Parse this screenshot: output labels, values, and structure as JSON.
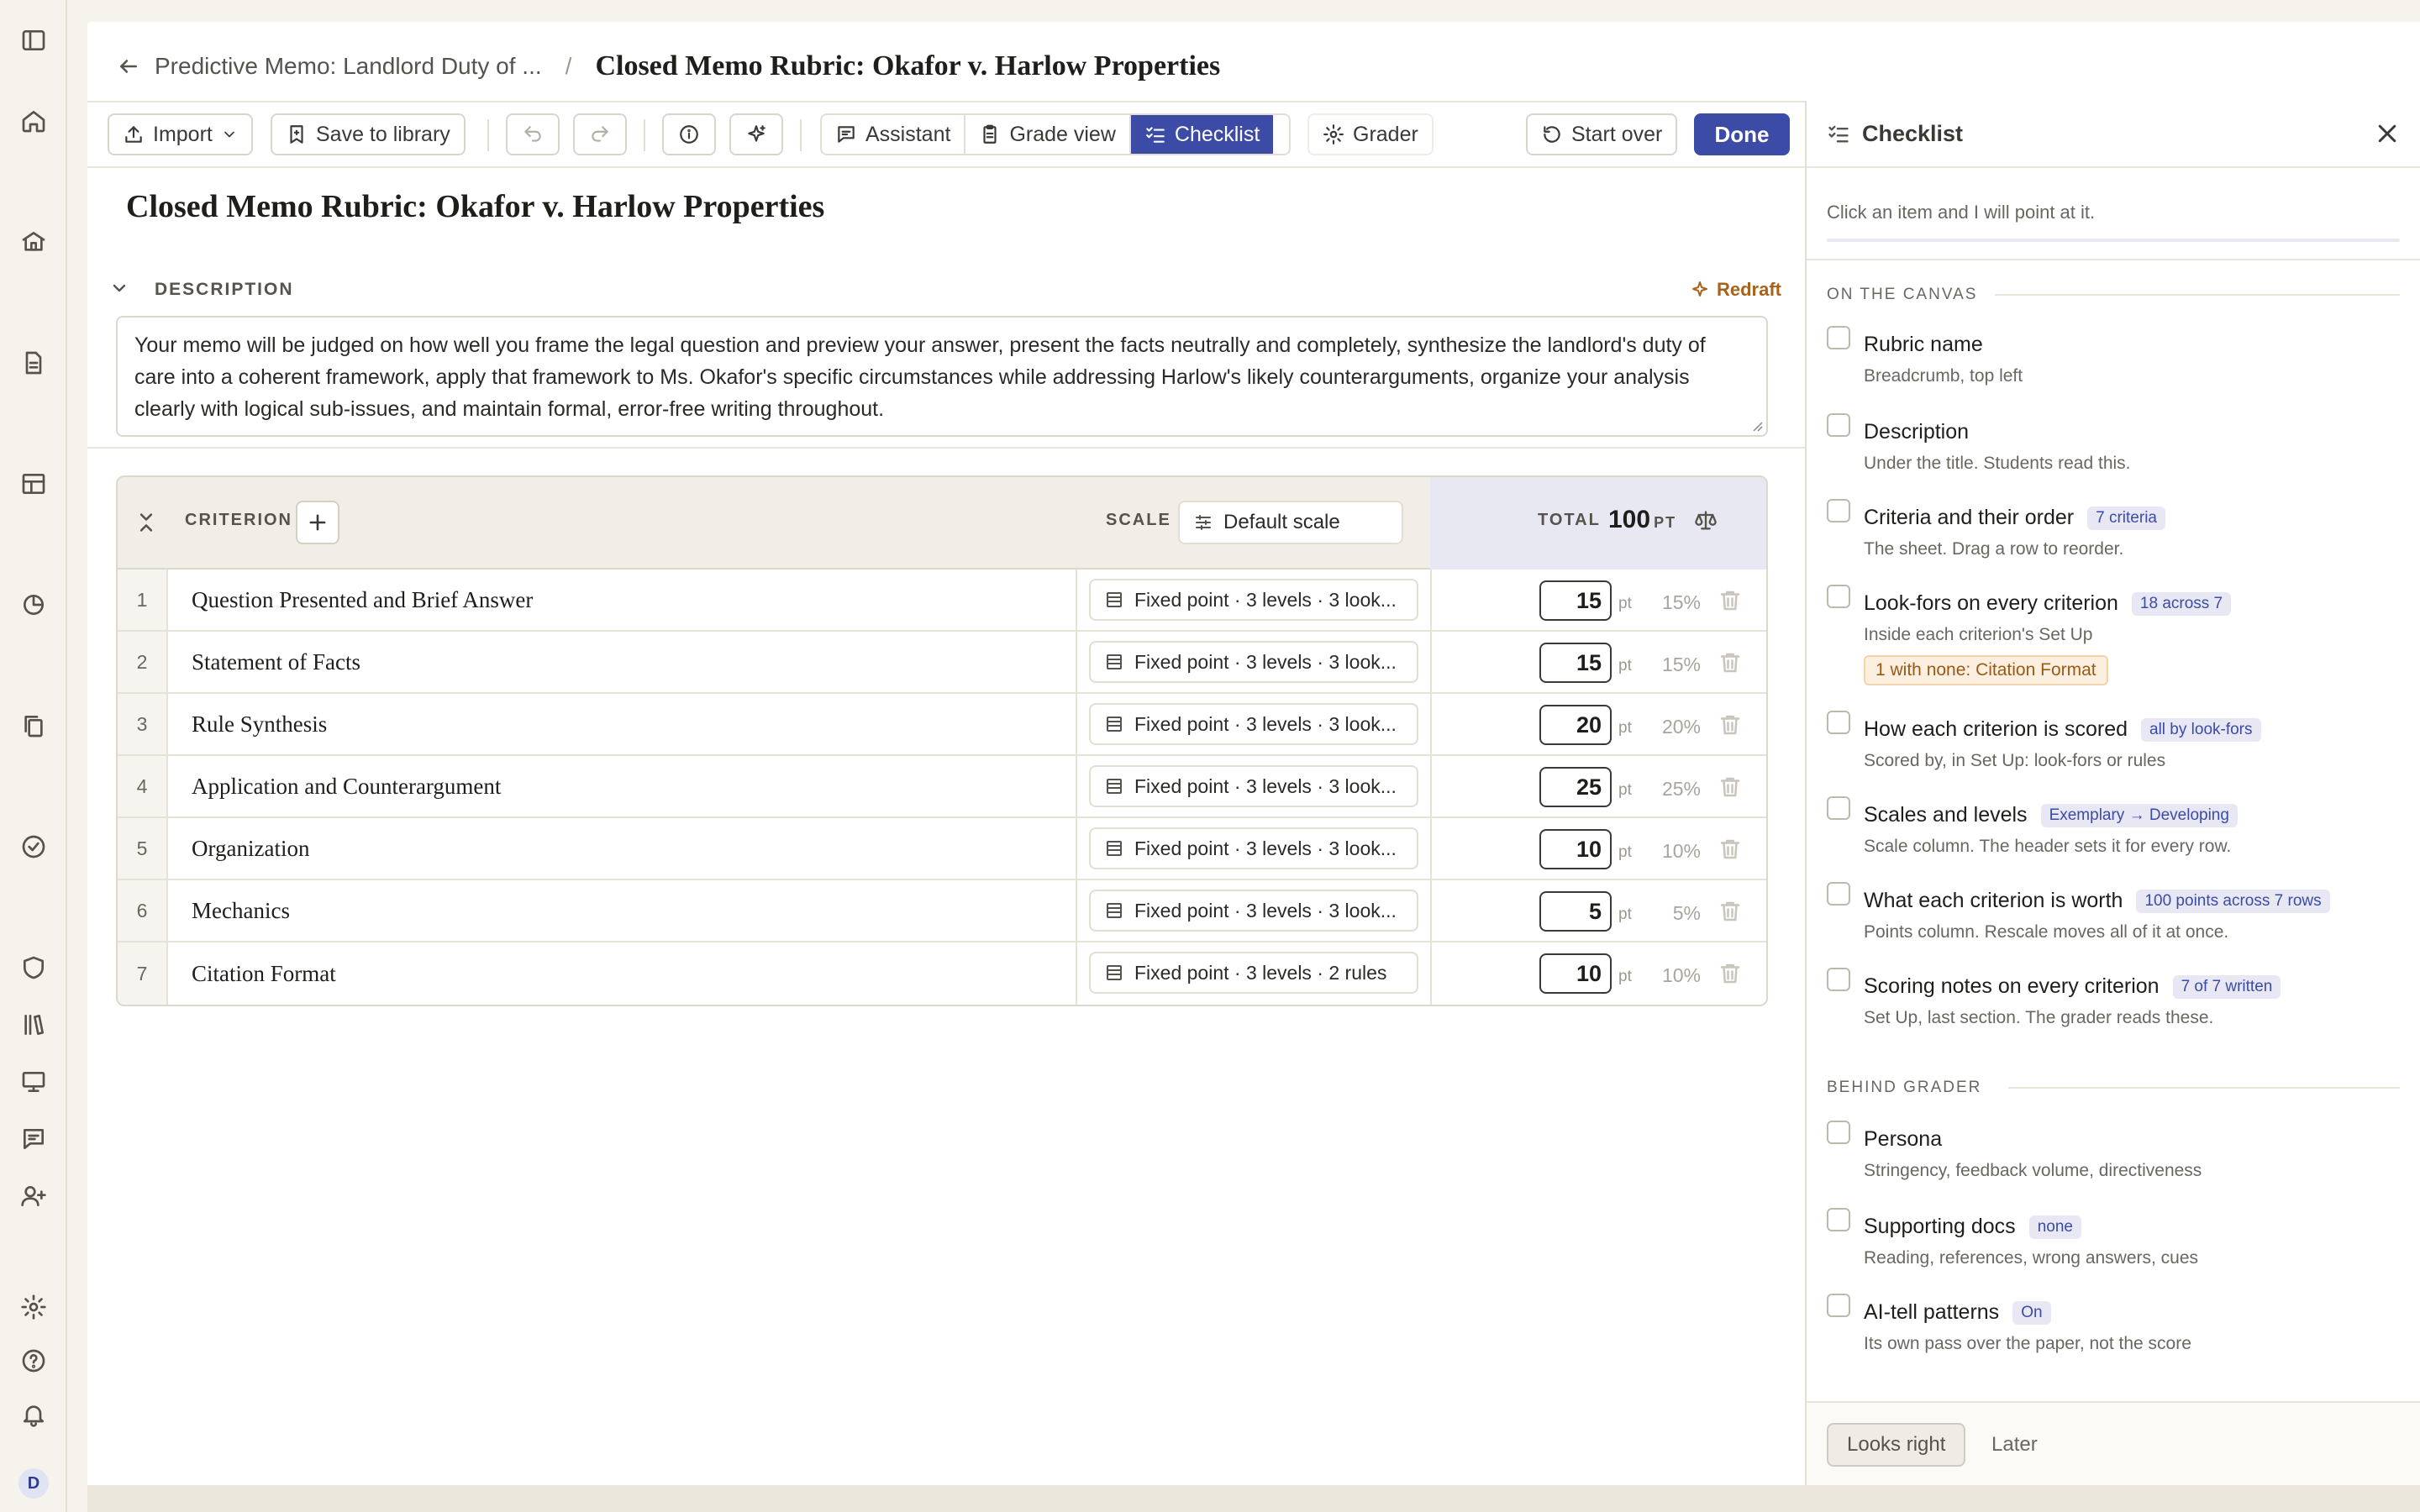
{
  "breadcrumb": {
    "parent": "Predictive Memo: Landlord Duty of ...",
    "separator": "/",
    "current": "Closed Memo Rubric: Okafor v. Harlow Properties"
  },
  "toolbar": {
    "import": "Import",
    "save": "Save to library",
    "assistant": "Assistant",
    "grade_view": "Grade view",
    "checklist": "Checklist",
    "grader": "Grader",
    "start_over": "Start over",
    "done": "Done"
  },
  "rubric": {
    "title": "Closed Memo Rubric: Okafor v. Harlow Properties",
    "description_label": "DESCRIPTION",
    "redraft": "Redraft",
    "description": "Your memo will be judged on how well you frame the legal question and preview your answer, present the facts neutrally and completely, synthesize the landlord's duty of care into a coherent framework, apply that framework to Ms. Okafor's specific circumstances while addressing Harlow's likely counterarguments, organize your analysis clearly with logical sub-issues, and maintain formal, error-free writing throughout."
  },
  "table": {
    "criterion_header": "CRITERION",
    "scale_header": "SCALE",
    "default_scale": "Default scale",
    "total_header": "TOTAL",
    "total_value": "100",
    "total_unit": "PT",
    "unit": "pt",
    "rows": [
      {
        "num": "1",
        "name": "Question Presented and Brief Answer",
        "scale": "Fixed point · 3 levels · 3 look...",
        "points": "15",
        "pct": "15%"
      },
      {
        "num": "2",
        "name": "Statement of Facts",
        "scale": "Fixed point · 3 levels · 3 look...",
        "points": "15",
        "pct": "15%"
      },
      {
        "num": "3",
        "name": "Rule Synthesis",
        "scale": "Fixed point · 3 levels · 3 look...",
        "points": "20",
        "pct": "20%"
      },
      {
        "num": "4",
        "name": "Application and Counterargument",
        "scale": "Fixed point · 3 levels · 3 look...",
        "points": "25",
        "pct": "25%"
      },
      {
        "num": "5",
        "name": "Organization",
        "scale": "Fixed point · 3 levels · 3 look...",
        "points": "10",
        "pct": "10%"
      },
      {
        "num": "6",
        "name": "Mechanics",
        "scale": "Fixed point · 3 levels · 3 look...",
        "points": "5",
        "pct": "5%"
      },
      {
        "num": "7",
        "name": "Citation Format",
        "scale": "Fixed point · 3 levels · 2 rules",
        "points": "10",
        "pct": "10%"
      }
    ]
  },
  "checklist": {
    "title": "Checklist",
    "hint": "Click an item and I will point at it.",
    "section_canvas": "ON THE CANVAS",
    "section_grader": "BEHIND GRADER",
    "canvas_items": [
      {
        "title": "Rubric name",
        "badge": "",
        "sub": "Breadcrumb, top left"
      },
      {
        "title": "Description",
        "badge": "",
        "sub": "Under the title. Students read this."
      },
      {
        "title": "Criteria and their order",
        "badge": "7 criteria",
        "sub": "The sheet. Drag a row to reorder."
      },
      {
        "title": "Look-fors on every criterion",
        "badge": "18 across 7",
        "sub": "Inside each criterion's Set Up",
        "warn": "1 with none: Citation Format"
      },
      {
        "title": "How each criterion is scored",
        "badge": "all by look-fors",
        "sub": "Scored by, in Set Up: look-fors or rules"
      },
      {
        "title": "Scales and levels",
        "badge": "Exemplary → Developing",
        "sub": "Scale column. The header sets it for every row."
      },
      {
        "title": "What each criterion is worth",
        "badge": "100 points across 7 rows",
        "sub": "Points column. Rescale moves all of it at once."
      },
      {
        "title": "Scoring notes on every criterion",
        "badge": "7 of 7 written",
        "sub": "Set Up, last section. The grader reads these."
      }
    ],
    "grader_items": [
      {
        "title": "Persona",
        "badge": "",
        "sub": "Stringency, feedback volume, directiveness"
      },
      {
        "title": "Supporting docs",
        "badge": "none",
        "sub": "Reading, references, wrong answers, cues"
      },
      {
        "title": "AI-tell patterns",
        "badge": "On",
        "sub": "Its own pass over the paper, not the score"
      }
    ],
    "looks_right": "Looks right",
    "later": "Later"
  },
  "user": {
    "avatar_initial": "D"
  },
  "colors": {
    "accent": "#3c4ba6",
    "warning": "#a7621b",
    "background": "#f6f3ec"
  }
}
